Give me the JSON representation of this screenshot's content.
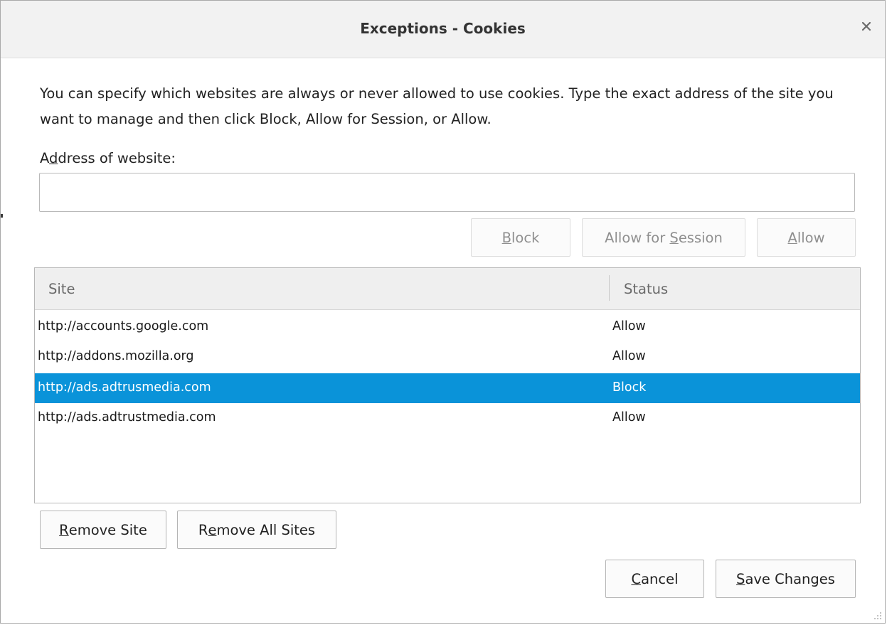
{
  "dialog": {
    "title": "Exceptions - Cookies",
    "intro_text": "You can specify which websites are always or never allowed to use cookies. Type the exact address of the site you want to manage and then click Block, Allow for Session, or Allow.",
    "address_label": {
      "pre": "A",
      "key": "d",
      "post": "dress of website:"
    },
    "address_value": "",
    "address_placeholder": ""
  },
  "action_buttons": {
    "block": {
      "key": "B",
      "rest": "lock"
    },
    "allow_session": {
      "pre": "Allow for ",
      "key": "S",
      "post": "ession"
    },
    "allow": {
      "key": "A",
      "rest": "llow"
    }
  },
  "table": {
    "columns": {
      "site": "Site",
      "status": "Status"
    },
    "rows": [
      {
        "site": "http://accounts.google.com",
        "status": "Allow",
        "selected": false
      },
      {
        "site": "http://addons.mozilla.org",
        "status": "Allow",
        "selected": false
      },
      {
        "site": "http://ads.adtrusmedia.com",
        "status": "Block",
        "selected": true
      },
      {
        "site": "http://ads.adtrustmedia.com",
        "status": "Allow",
        "selected": false
      }
    ],
    "selected_color": "#0a93d9"
  },
  "remove_buttons": {
    "remove_site": {
      "key": "R",
      "rest": "emove Site"
    },
    "remove_all": {
      "pre": "R",
      "key": "e",
      "post": "move All Sites"
    }
  },
  "footer_buttons": {
    "cancel": {
      "key": "C",
      "rest": "ancel"
    },
    "save": {
      "key": "S",
      "rest": "ave Changes"
    }
  },
  "icons": {
    "close": "close-icon",
    "resize": "resize-grip-icon"
  }
}
